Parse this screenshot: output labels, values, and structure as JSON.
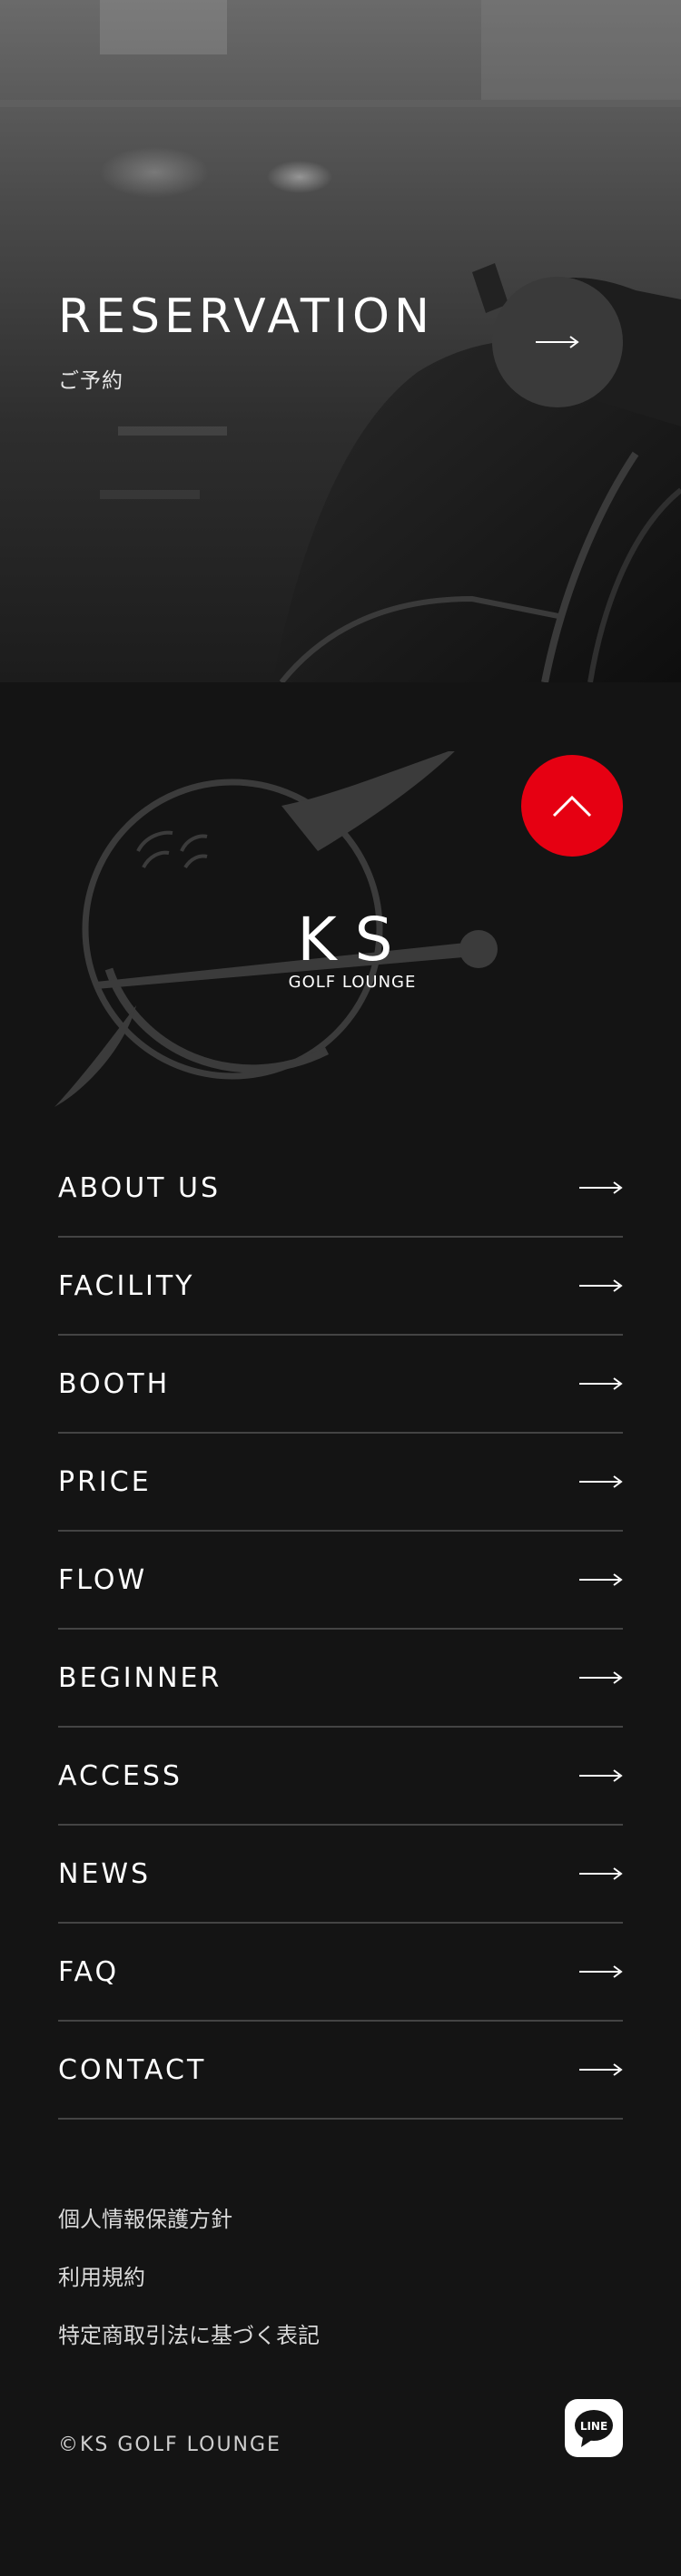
{
  "hero": {
    "title": "RESERVATION",
    "subtitle": "ご予約"
  },
  "logo": {
    "mark": "KS",
    "tagline": "GOLF LOUNGE"
  },
  "nav": [
    {
      "label": "ABOUT US"
    },
    {
      "label": "FACILITY"
    },
    {
      "label": "BOOTH"
    },
    {
      "label": "PRICE"
    },
    {
      "label": "FLOW"
    },
    {
      "label": "BEGINNER"
    },
    {
      "label": "ACCESS"
    },
    {
      "label": "NEWS"
    },
    {
      "label": "FAQ"
    },
    {
      "label": "CONTACT"
    }
  ],
  "links": {
    "privacy": "個人情報保護方針",
    "terms": "利用規約",
    "commerce": "特定商取引法に基づく表記"
  },
  "copyright": "©KS GOLF LOUNGE",
  "line_label": "LINE",
  "colors": {
    "background": "#141414",
    "accent": "#e60012",
    "divider": "#444444"
  },
  "icons": {
    "reservation": "arrow-right-icon",
    "page_top": "chevron-up-icon",
    "nav": "arrow-right-icon",
    "social": "line-icon"
  }
}
